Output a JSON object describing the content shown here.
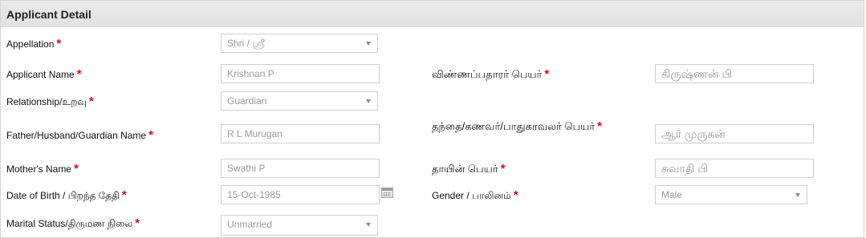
{
  "panel": {
    "title": "Applicant Detail"
  },
  "required_mark": "*",
  "form": {
    "appellation": {
      "label": "Appellation",
      "value": "Shri / ஸ்ரீ"
    },
    "applicant_name": {
      "label": "Applicant Name",
      "value": "Krishnan P"
    },
    "applicant_name_tamil": {
      "label": "விண்ணப்பதாரர் பெயர்",
      "value": "கிருஷ்ணன் பி"
    },
    "relationship": {
      "label": "Relationship/உறவு",
      "value": "Guardian"
    },
    "father_name": {
      "label": "Father/Husband/Guardian Name",
      "value": "R L Murugan"
    },
    "father_name_tamil": {
      "label": "தந்தை/கணவர்/பாதுகாவலர் பெயர்",
      "value": "ஆர் முருகன்"
    },
    "mother_name": {
      "label": "Mother's Name",
      "value": "Swathi P"
    },
    "mother_name_tamil": {
      "label": "தாயின் பெயர்",
      "value": "சுவாதி பி"
    },
    "dob": {
      "label": "Date of Birth / பிறந்த தேதி",
      "value": "15-Oct-1985"
    },
    "gender": {
      "label": "Gender / பாலினம்",
      "value": "Male"
    },
    "marital_status": {
      "label": "Marital Status/திருமண நிலை",
      "value": "Unmarried"
    }
  },
  "icons": {
    "calendar": "calendar-icon",
    "dropdown": "chevron-down-icon"
  },
  "colors": {
    "required": "#e0001b",
    "header_bg": "#e6e6e6",
    "field_text": "#9a9a9a"
  }
}
